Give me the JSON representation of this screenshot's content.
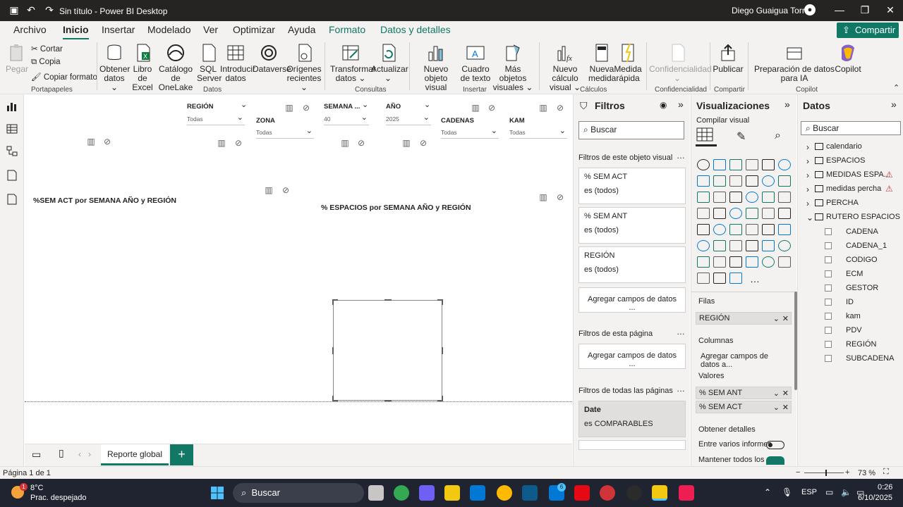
{
  "window": {
    "title": "Sin título - Power BI Desktop",
    "user": "Diego Guaigua Torres"
  },
  "tabs": [
    "Archivo",
    "Inicio",
    "Insertar",
    "Modelado",
    "Ver",
    "Optimizar",
    "Ayuda",
    "Formato",
    "Datos y detalles"
  ],
  "share_label": "Compartir",
  "ribbon": {
    "paste": "Pegar",
    "cut": "Cortar",
    "copy": "Copia",
    "copy_format": "Copiar formato",
    "get_data": "Obtener datos",
    "excel": "Libro de Excel",
    "onelake": "Catálogo de OneLake",
    "sql": "SQL Server",
    "enter_data": "Introducir datos",
    "dataverse": "Dataverse",
    "recent": "Orígenes recientes",
    "transform": "Transformar datos",
    "refresh": "Actualizar",
    "new_visual": "Nuevo objeto visual",
    "textbox": "Cuadro de texto",
    "more_visuals": "Más objetos visuales",
    "new_calc": "Nuevo cálculo visual",
    "new_measure": "Nueva medida",
    "quick_measure": "Medida rápida",
    "sensitivity": "Confidencialidad",
    "publish": "Publicar",
    "prep_ai": "Preparación de datos para IA",
    "copilot": "Copilot",
    "groups": {
      "clipboard": "Portapapeles",
      "data": "Datos",
      "queries": "Consultas",
      "insert": "Insertar",
      "calcs": "Cálculos",
      "sens": "Confidencialidad",
      "share": "Compartir",
      "copilot": "Copilot"
    }
  },
  "slicers": [
    {
      "title": "REGIÓN",
      "value": "Todas"
    },
    {
      "title": "ZONA",
      "value": "Todas"
    },
    {
      "title": "SEMANA ...",
      "value": "40"
    },
    {
      "title": "AÑO",
      "value": "2025"
    },
    {
      "title": "CADENAS",
      "value": "Todas"
    },
    {
      "title": "KAM",
      "value": "Todas"
    }
  ],
  "visuals": {
    "v1": "%SEM ACT por SEMANA AÑO y REGIÓN",
    "v2": "% ESPACIOS por SEMANA AÑO y REGIÓN"
  },
  "filters": {
    "title": "Filtros",
    "search": "Buscar",
    "visual_section": "Filtros de este objeto visual",
    "cards": [
      {
        "name": "% SEM ACT",
        "value": "es (todos)"
      },
      {
        "name": "% SEM ANT",
        "value": "es (todos)"
      },
      {
        "name": "REGIÓN",
        "value": "es (todos)"
      }
    ],
    "add_fields": "Agregar campos de datos ...",
    "page_section": "Filtros de esta página",
    "all_section": "Filtros de todas las páginas",
    "date_card": {
      "name": "Date",
      "value": "es COMPARABLES"
    }
  },
  "viz": {
    "title": "Visualizaciones",
    "build": "Compilar visual",
    "rows_label": "Filas",
    "rows_field": "REGIÓN",
    "cols_label": "Columnas",
    "cols_add": "Agregar campos de datos a...",
    "values_label": "Valores",
    "values": [
      "% SEM ANT",
      "% SEM ACT"
    ],
    "details": "Obtener detalles",
    "cross_report": "Entre varios informes",
    "keep_all": "Mantener todos los"
  },
  "data": {
    "title": "Datos",
    "search": "Buscar",
    "tables": [
      "calendario",
      "ESPACIOS",
      "MEDIDAS ESPA...",
      "medidas percha",
      "PERCHA",
      "RUTERO ESPACIOS"
    ],
    "fields": [
      "CADENA",
      "CADENA_1",
      "CODIGO",
      "ECM",
      "GESTOR",
      "ID",
      "kam",
      "PDV",
      "REGIÓN",
      "SUBCADENA"
    ]
  },
  "page_tab": "Reporte global",
  "status": {
    "page": "Página 1 de 1",
    "zoom": "73 %"
  },
  "taskbar": {
    "temp": "8°C",
    "weather": "Prac. despejado",
    "search": "Buscar",
    "lang": "ESP",
    "time": "0:26",
    "date": "6/10/2025",
    "badge": "1",
    "badge2": "6"
  },
  "colors": {
    "accent": "#117865",
    "titlebar": "#252423",
    "ribbon": "#f3f2f1",
    "warning": "#d13438"
  }
}
